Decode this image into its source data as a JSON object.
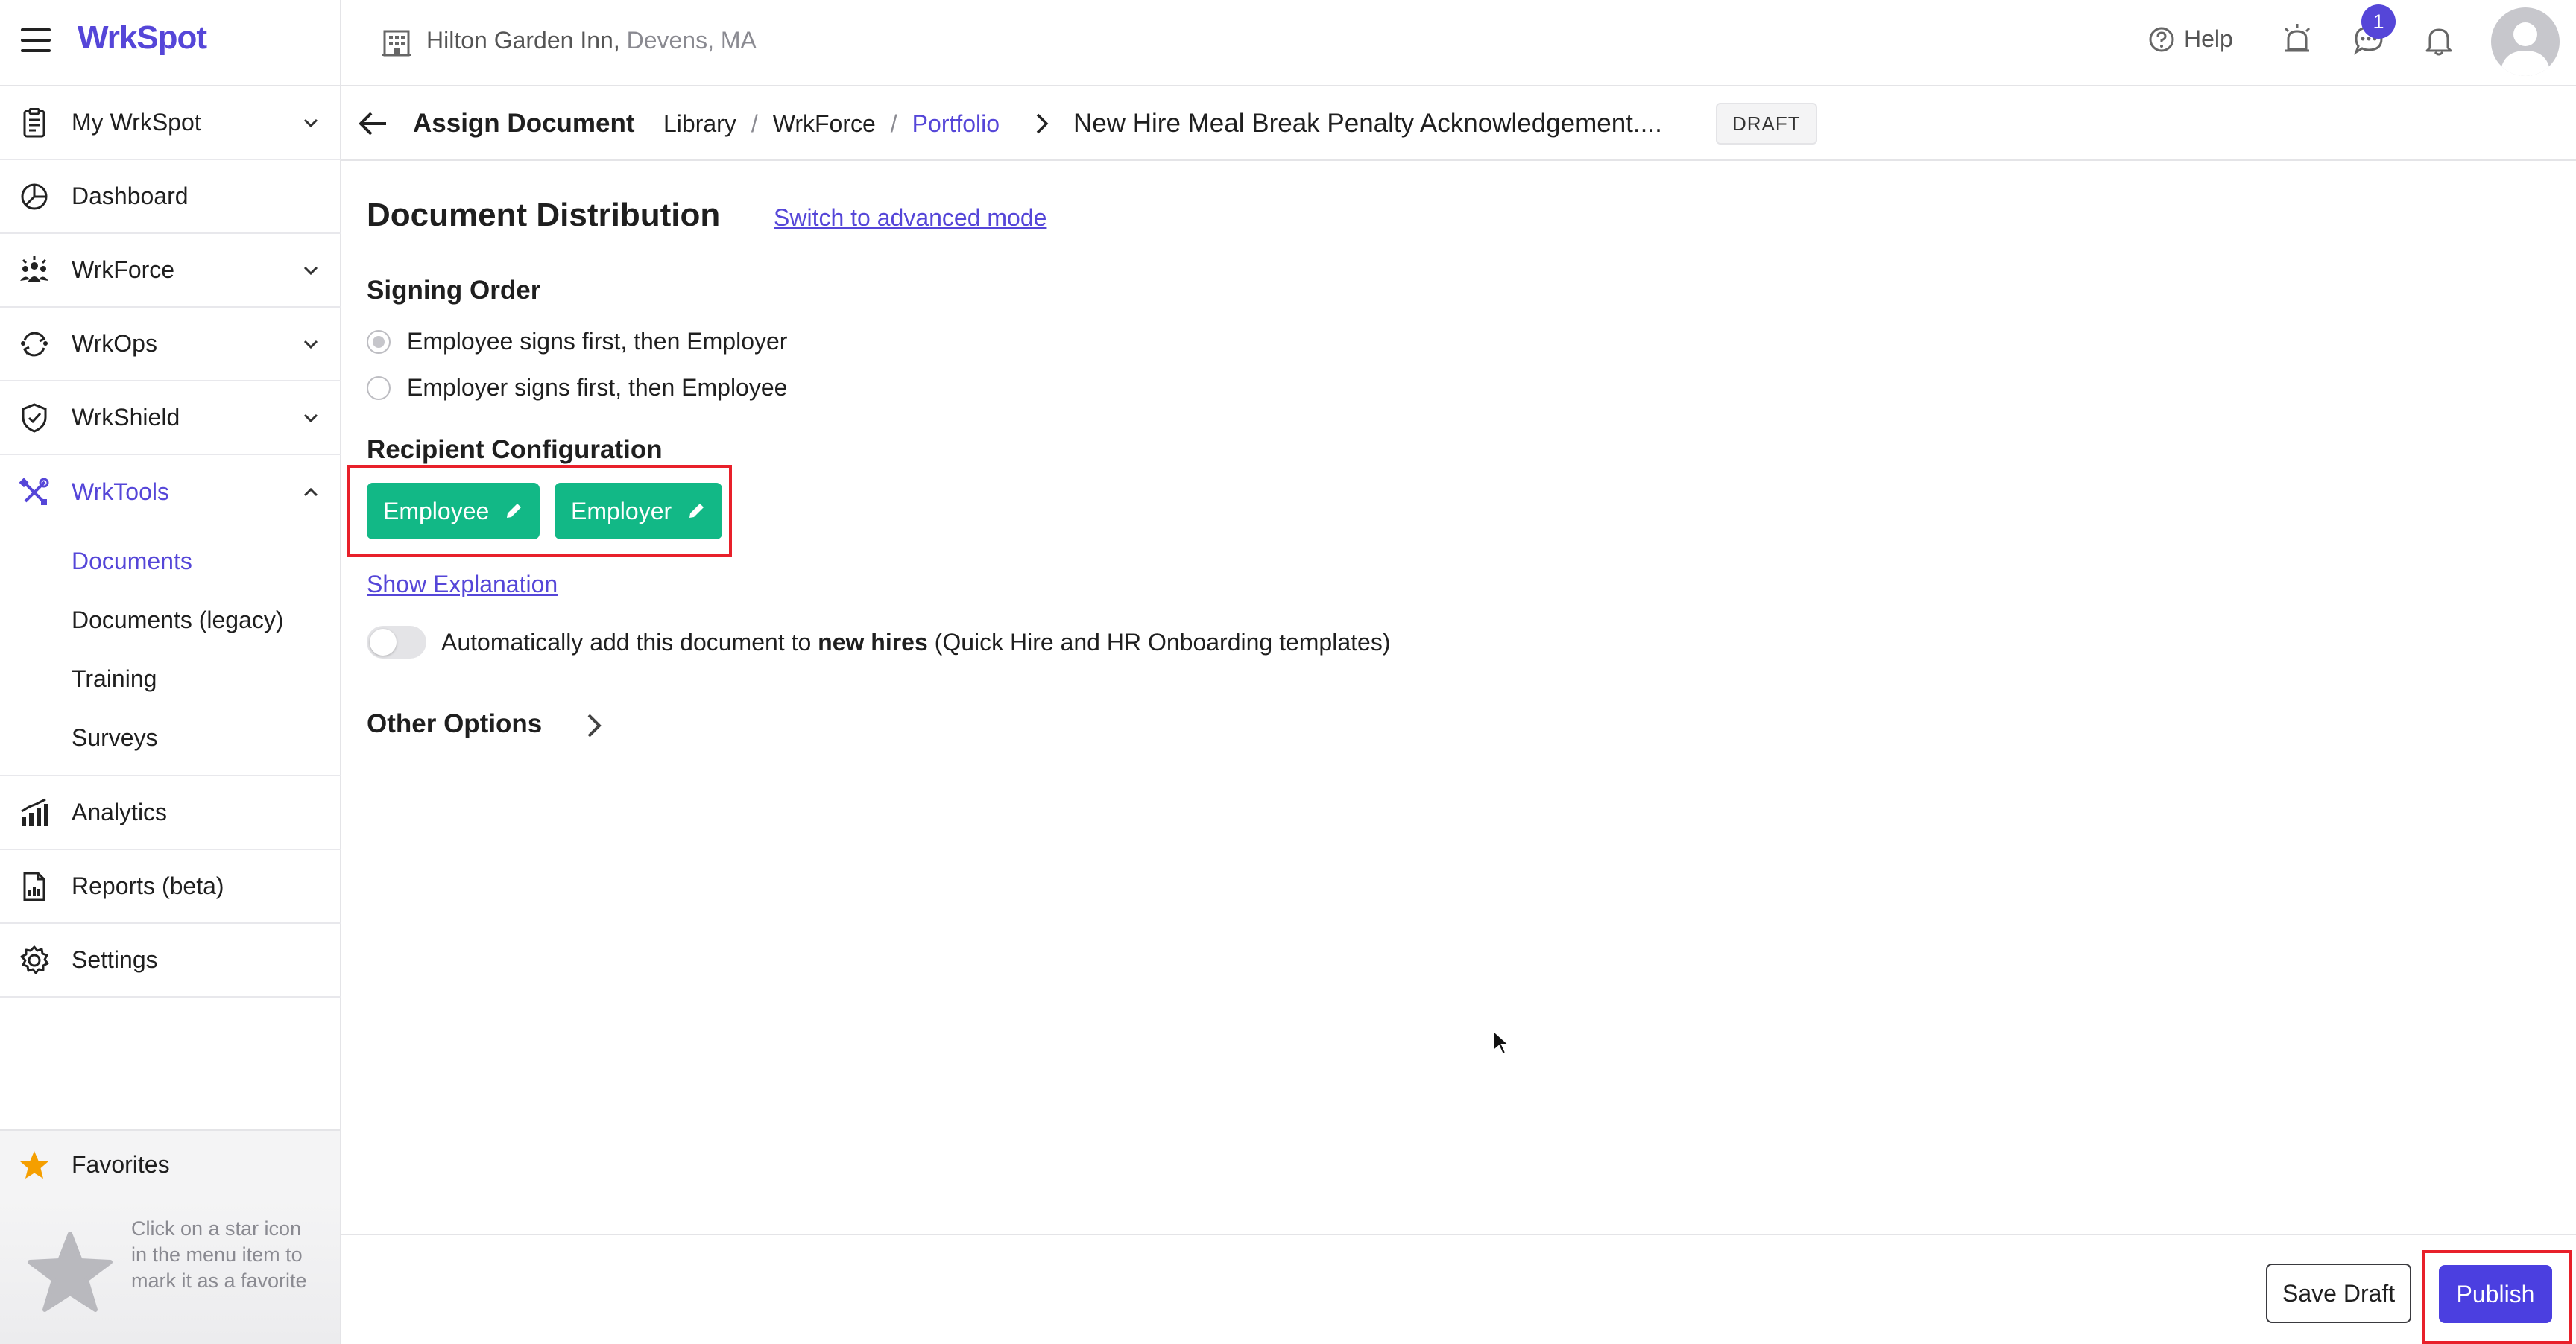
{
  "app": {
    "logo_text": "WrkSpot",
    "brand_color": "#5546d8"
  },
  "topbar": {
    "hotel_name": "Hilton Garden Inn,",
    "hotel_location": " Devens, MA",
    "help_label": "Help",
    "chat_badge_count": "1"
  },
  "sidebar": {
    "items": [
      {
        "label": "My WrkSpot",
        "icon": "clipboard-icon",
        "expandable": true
      },
      {
        "label": "Dashboard",
        "icon": "pie-chart-icon",
        "expandable": false
      },
      {
        "label": "WrkForce",
        "icon": "team-icon",
        "expandable": true
      },
      {
        "label": "WrkOps",
        "icon": "cycle-icon",
        "expandable": true
      },
      {
        "label": "WrkShield",
        "icon": "shield-icon",
        "expandable": true
      },
      {
        "label": "WrkTools",
        "icon": "tools-icon",
        "expandable": true,
        "expanded": true
      },
      {
        "label": "Analytics",
        "icon": "bar-chart-icon",
        "expandable": false
      },
      {
        "label": "Reports (beta)",
        "icon": "report-icon",
        "expandable": false
      },
      {
        "label": "Settings",
        "icon": "gear-icon",
        "expandable": false
      }
    ],
    "wrktools_sub": [
      {
        "label": "Documents",
        "active": true
      },
      {
        "label": "Documents (legacy)",
        "active": false
      },
      {
        "label": "Training",
        "active": false
      },
      {
        "label": "Surveys",
        "active": false
      }
    ],
    "favorites": {
      "label": "Favorites",
      "hint": "Click on a star icon in the menu item to mark it as a favorite"
    }
  },
  "breadcrumb": {
    "title": "Assign Document",
    "items": [
      "Library",
      "WrkForce",
      "Portfolio"
    ],
    "separator": "/",
    "document_name": "New Hire Meal Break Penalty Acknowledgement....",
    "status_badge": "DRAFT"
  },
  "main": {
    "heading": "Document Distribution",
    "advanced_link": "Switch to advanced mode",
    "signing_order": {
      "heading": "Signing Order",
      "options": [
        {
          "label": "Employee signs first, then Employer",
          "selected": true
        },
        {
          "label": "Employer signs first, then Employee",
          "selected": false
        }
      ]
    },
    "recipients": {
      "heading": "Recipient Configuration",
      "buttons": [
        "Employee",
        "Employer"
      ],
      "button_color": "#12b886"
    },
    "show_explanation": "Show Explanation",
    "auto_add": {
      "prefix": "Automatically add this document to ",
      "bold": "new hires",
      "suffix": " (Quick Hire and HR Onboarding templates)",
      "enabled": false
    },
    "other_options": "Other Options"
  },
  "footer": {
    "save_draft": "Save Draft",
    "publish": "Publish",
    "publish_color": "#4b3fe0",
    "highlight_color": "#e8202a"
  }
}
